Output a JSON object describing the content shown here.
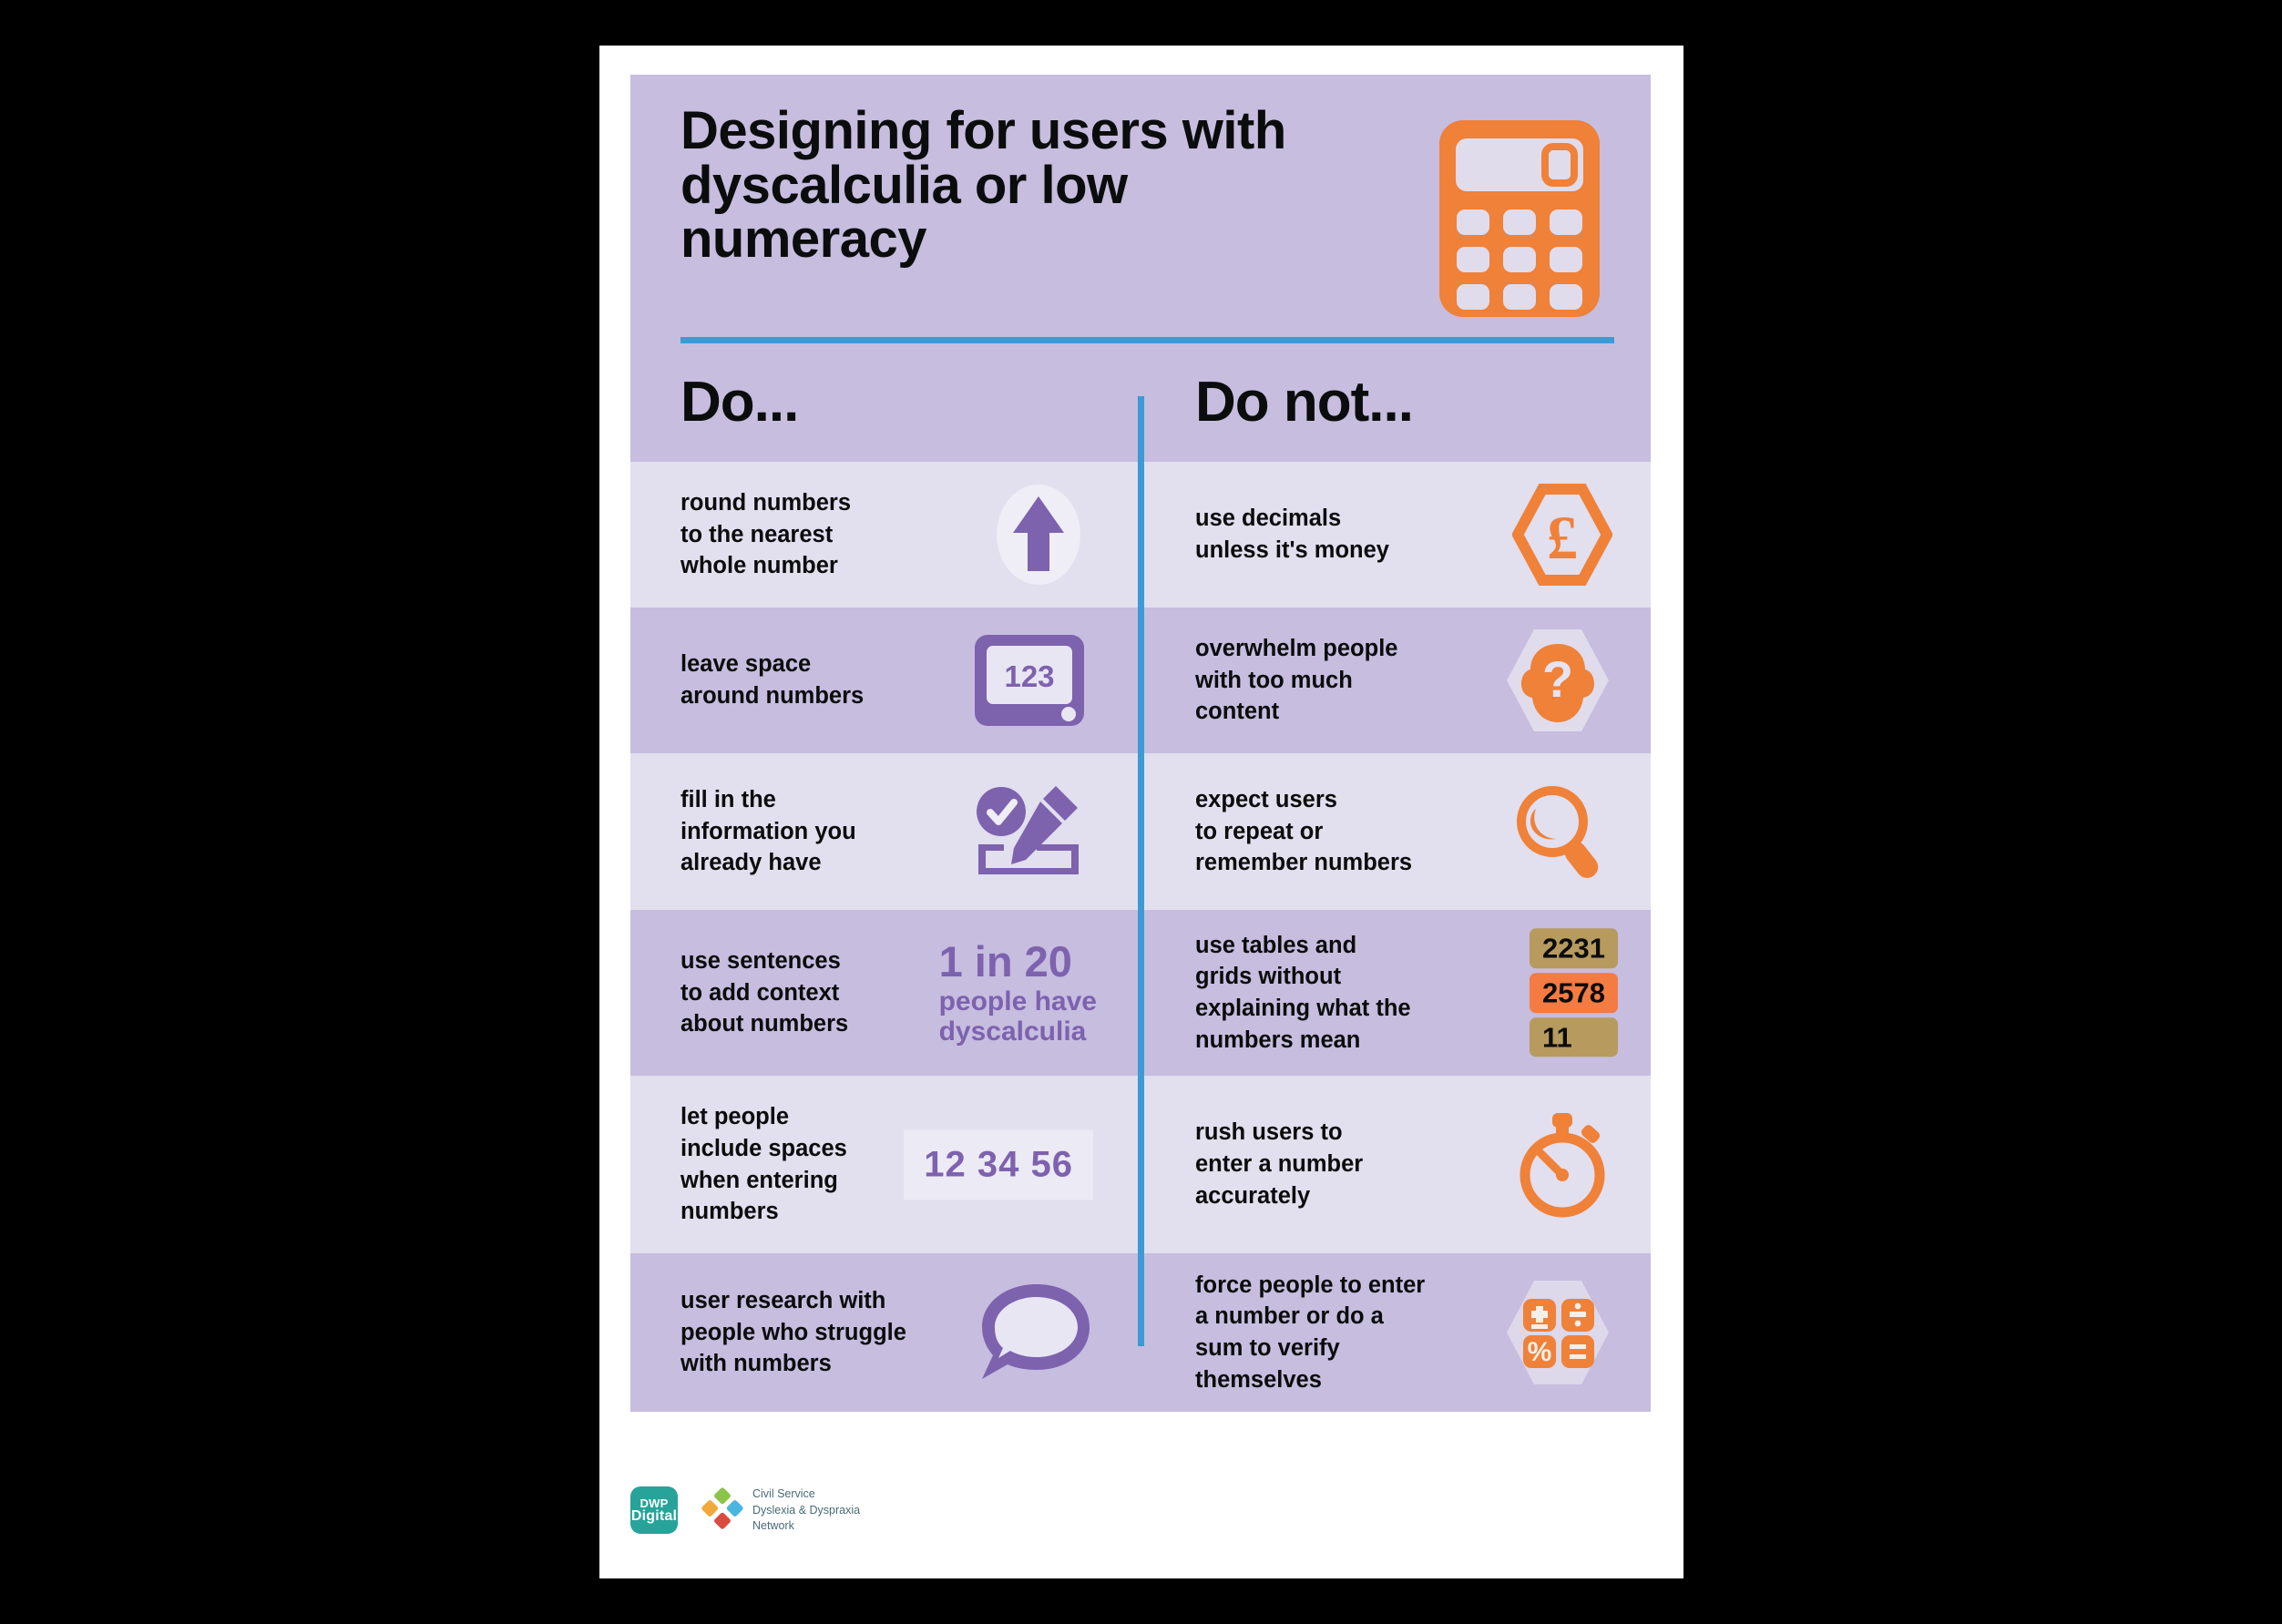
{
  "poster": {
    "title": "Designing for users with dyscalculia or low numeracy",
    "header_icon": "calculator-icon",
    "columns": {
      "do_label": "Do...",
      "do_not_label": "Do not..."
    },
    "colors": {
      "header_bg": "#c6bddf",
      "row_dark": "#c6bddf",
      "row_light": "#e2dfee",
      "divider_blue": "#3d9ad4",
      "purple": "#7d62ae",
      "orange": "#ef8139",
      "tile_tan": "#b79a5e",
      "tile_orange": "#f47b42",
      "teal": "#27a39a",
      "page_white": "#ffffff",
      "text_black": "#0b0c0c"
    },
    "rows": [
      {
        "band": "light",
        "do_text": "round numbers\nto the nearest\nwhole number",
        "do_icon": "up-arrow-icon",
        "do_not_text": "use decimals\nunless it's money",
        "do_not_icon": "pound-hexagon-icon"
      },
      {
        "band": "dark",
        "do_text": "leave space\naround numbers",
        "do_icon": "tablet-123-icon",
        "do_icon_value": "123",
        "do_not_text": "overwhelm people\nwith too much\ncontent",
        "do_not_icon": "question-head-hexagon-icon"
      },
      {
        "band": "light",
        "do_text": "fill in the\ninformation you\nalready have",
        "do_icon": "check-pencil-form-icon",
        "do_not_text": "expect users\nto repeat or\nremember numbers",
        "do_not_icon": "magnifying-glass-icon"
      },
      {
        "band": "dark",
        "do_text": "use sentences\nto add context\nabout numbers",
        "do_stat_big": "1 in 20",
        "do_stat_small_1": "people have",
        "do_stat_small_2": "dyscalculia",
        "do_not_text": "use tables and\ngrids without\nexplaining what the\nnumbers mean",
        "do_not_tiles": [
          {
            "value": "2231",
            "color": "#b79a5e"
          },
          {
            "value": "2578",
            "color": "#f47b42"
          },
          {
            "value": "11",
            "color": "#b79a5e"
          }
        ]
      },
      {
        "band": "light",
        "do_text": "let people\ninclude spaces\nwhen entering\nnumbers",
        "do_numbox": "12 34 56",
        "do_not_text": "rush users to\nenter a number\naccurately",
        "do_not_icon": "stopwatch-icon"
      },
      {
        "band": "dark",
        "do_text": "user research with\npeople who struggle\nwith numbers",
        "do_icon": "speech-bubble-icon",
        "do_not_text": "force people to enter\na number or do a\nsum to verify\nthemselves",
        "do_not_icon": "math-symbols-hexagon-icon"
      }
    ],
    "footer": {
      "dwp_line1": "DWP",
      "dwp_line2": "Digital",
      "csdn_text": "Civil Service\nDyslexia & Dyspraxia\nNetwork"
    }
  }
}
